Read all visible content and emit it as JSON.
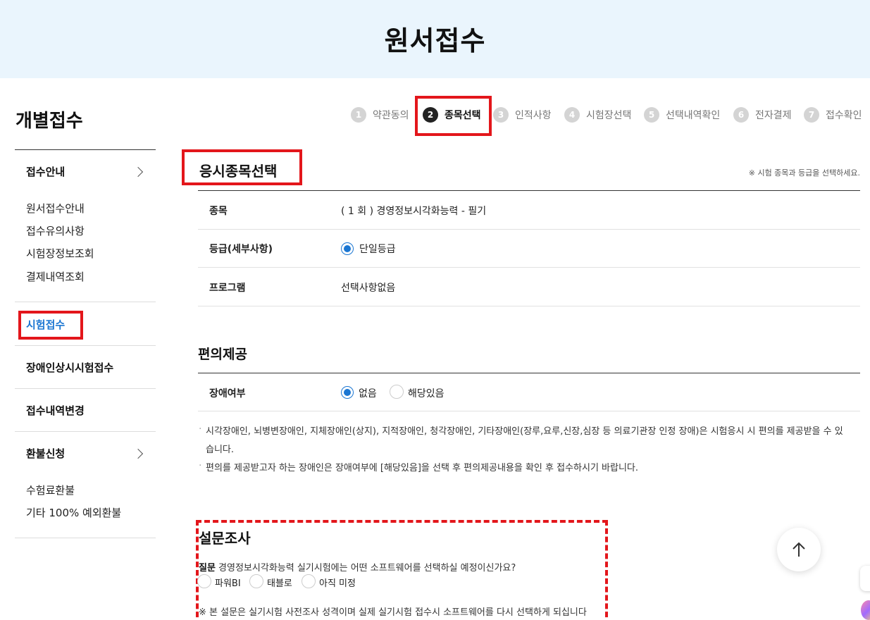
{
  "banner": {
    "title": "원서접수"
  },
  "sidebar": {
    "title": "개별접수",
    "groups": [
      {
        "label": "접수안내",
        "items": [
          "원서접수안내",
          "접수유의사항",
          "시험장정보조회",
          "결제내역조회"
        ]
      },
      {
        "label": "시험접수"
      },
      {
        "label": "장애인상시시험접수"
      },
      {
        "label": "접수내역변경"
      },
      {
        "label": "환불신청",
        "items": [
          "수험료환불",
          "기타 100% 예외환불"
        ]
      }
    ]
  },
  "steps": [
    {
      "num": "1",
      "label": "약관동의"
    },
    {
      "num": "2",
      "label": "종목선택"
    },
    {
      "num": "3",
      "label": "인적사항"
    },
    {
      "num": "4",
      "label": "시험장선택"
    },
    {
      "num": "5",
      "label": "선택내역확인"
    },
    {
      "num": "6",
      "label": "전자결제"
    },
    {
      "num": "7",
      "label": "접수확인"
    }
  ],
  "exam_select": {
    "title": "응시종목선택",
    "note": "※ 시험 종목과 등급을 선택하세요.",
    "rows": [
      {
        "label": "종목",
        "value": "( 1 회 ) 경영정보시각화능력 - 필기"
      },
      {
        "label": "등급(세부사항)",
        "option": "단일등급"
      },
      {
        "label": "프로그램",
        "value": "선택사항없음"
      }
    ]
  },
  "accommodation": {
    "title": "편의제공",
    "row_label": "장애여부",
    "options": [
      "없음",
      "해당있음"
    ],
    "selected": "없음",
    "notes": [
      "시각장애인, 뇌병변장애인, 지체장애인(상지), 지적장애인, 청각장애인, 기타장애인(장루,요루,신장,심장 등 의료기관장 인정 장애)은 시험응시 시 편의를 제공받을 수 있습니다.",
      "편의를 제공받고자 하는 장애인은 장애여부에 [해당있음]을 선택 후 편의제공내용을 확인 후 접수하시기 바랍니다."
    ]
  },
  "survey": {
    "title": "설문조사",
    "question_prefix": "질문",
    "question": " 경영정보시각화능력 실기시험에는 어떤 소프트웨어를 선택하실 예정이신가요?",
    "options": [
      "파워BI",
      "태블로",
      "아직 미정"
    ],
    "footnote": "※ 본 설문은 실기시험 사전조사 성격이며 실제 실기시험 접수시 소프트웨어를 다시 선택하게 되십니다"
  },
  "colors": {
    "accent": "#1b76d2",
    "highlight": "#e3161b",
    "banner_bg": "#eaf5fd"
  },
  "icons": {
    "top_button": "arrow-up-icon",
    "menu_toggle": "chevron-right-icon"
  }
}
